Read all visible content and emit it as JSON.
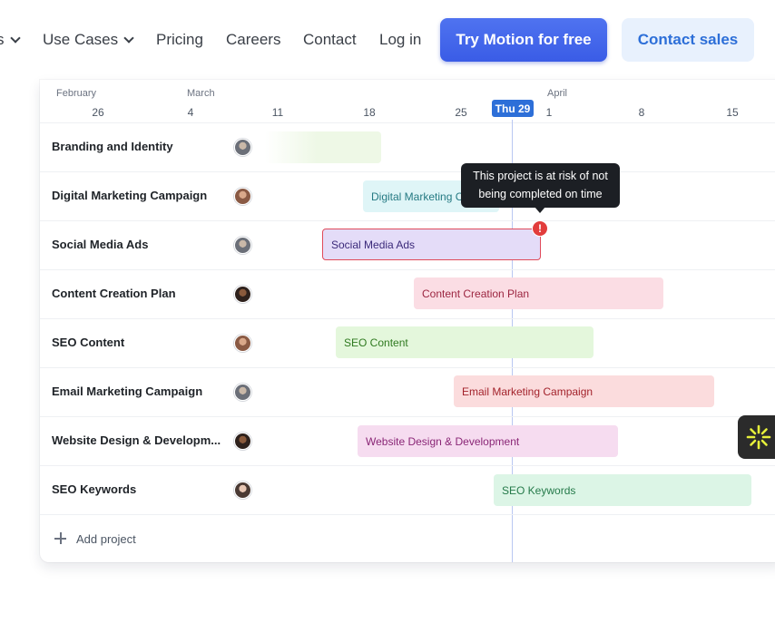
{
  "nav": {
    "partial_item": "s",
    "use_cases": "Use Cases",
    "pricing": "Pricing",
    "careers": "Careers",
    "contact": "Contact",
    "login": "Log in",
    "try_free": "Try Motion for free",
    "contact_sales": "Contact sales"
  },
  "timeline": {
    "months": [
      "February",
      "March",
      "April"
    ],
    "days": [
      "26",
      "4",
      "11",
      "18",
      "25",
      "1",
      "8",
      "15"
    ],
    "today": "Thu 29"
  },
  "projects": [
    {
      "name": "Branding and Identity",
      "bar": "",
      "color": "#eef8e6",
      "text_color": "#3f6b2a"
    },
    {
      "name": "Digital Marketing Campaign",
      "bar": "Digital Marketing Campaign",
      "color": "#dff5f7",
      "text_color": "#257a83"
    },
    {
      "name": "Social Media Ads",
      "bar": "Social Media Ads",
      "color": "#e4dcf8",
      "text_color": "#3b2a7a",
      "at_risk": true
    },
    {
      "name": "Content Creation Plan",
      "bar": "Content Creation Plan",
      "color": "#fbdde4",
      "text_color": "#9c2540"
    },
    {
      "name": "SEO Content",
      "bar": "SEO Content",
      "color": "#e4f7dc",
      "text_color": "#2f7a20"
    },
    {
      "name": "Email Marketing Campaign",
      "bar": "Email Marketing Campaign",
      "color": "#fbdcdd",
      "text_color": "#a3222b"
    },
    {
      "name": "Website Design & Developm...",
      "bar": "Website Design & Development",
      "color": "#f6dcf0",
      "text_color": "#8a2676"
    },
    {
      "name": "SEO Keywords",
      "bar": "SEO Keywords",
      "color": "#dcf5e6",
      "text_color": "#257a4a"
    }
  ],
  "add_project": "Add project",
  "tooltip": {
    "line1": "This project is at risk of not",
    "line2": "being completed on time",
    "alert": "!"
  },
  "colors": {
    "primary": "#3a5ce6",
    "secondary_bg": "#e8f1fd",
    "today": "#2d6fd8",
    "alert": "#e23c3c"
  },
  "icons": {
    "widget": "asterisk-burst-icon"
  }
}
